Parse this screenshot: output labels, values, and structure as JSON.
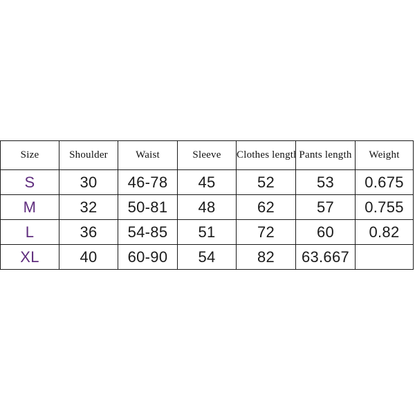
{
  "page": {
    "background_color": "#ffffff",
    "size_text_color": "#5f2d7e",
    "body_text_color": "#1b1b1b",
    "border_color": "#1a1a1a"
  },
  "chart_data": {
    "type": "table",
    "title": "",
    "columns": [
      "Size",
      "Shoulder",
      "Waist",
      "Sleeve",
      "Clothes length",
      "Pants length",
      "Weight"
    ],
    "rows": [
      {
        "size": "S",
        "shoulder": "30",
        "waist": "46-78",
        "sleeve": "45",
        "clothes_length": "52",
        "pants_length": "53",
        "weight": "0.675"
      },
      {
        "size": "M",
        "shoulder": "32",
        "waist": "50-81",
        "sleeve": "48",
        "clothes_length": "62",
        "pants_length": "57",
        "weight": "0.755"
      },
      {
        "size": "L",
        "shoulder": "36",
        "waist": "54-85",
        "sleeve": "51",
        "clothes_length": "72",
        "pants_length": "60",
        "weight": "0.82"
      },
      {
        "size": "XL",
        "shoulder": "40",
        "waist": "60-90",
        "sleeve": "54",
        "clothes_length": "82",
        "pants_length": "63.667",
        "weight": ""
      }
    ]
  }
}
